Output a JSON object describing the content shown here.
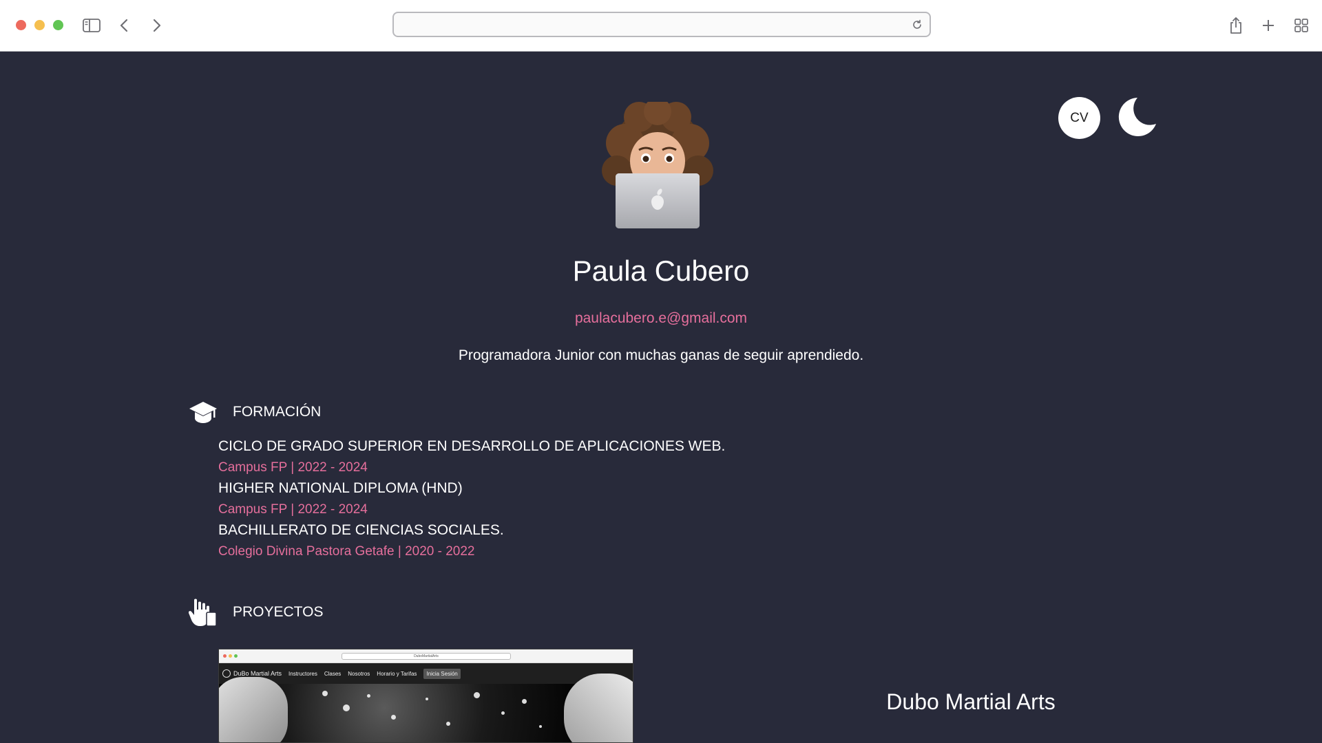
{
  "browser": {
    "url_text": "",
    "colors": {
      "close": "#ed6a5e",
      "minimize": "#f5bf4f",
      "zoom": "#61c554"
    }
  },
  "header": {
    "cv_label": "CV",
    "theme_toggle_icon": "moon-icon"
  },
  "profile": {
    "name": "Paula Cubero",
    "email": "paulacubero.e@gmail.com",
    "bio": "Programadora Junior con muchas ganas de seguir aprendiedo."
  },
  "formacion": {
    "title": "FORMACIÓN",
    "icon": "graduation-cap-icon",
    "items": [
      {
        "degree": "CICLO DE GRADO SUPERIOR EN DESARROLLO DE APLICACIONES WEB.",
        "school": "Campus FP | 2022 - 2024"
      },
      {
        "degree": "HIGHER NATIONAL DIPLOMA (HND)",
        "school": "Campus FP | 2022 - 2024"
      },
      {
        "degree": "BACHILLERATO DE CIENCIAS SOCIALES.",
        "school": "Colegio Divina Pastora Getafe | 2020 - 2022"
      }
    ]
  },
  "proyectos": {
    "title": "PROYECTOS",
    "icon": "hand-pointer-icon",
    "items": [
      {
        "title": "Dubo Martial Arts",
        "thumbnail": {
          "url": "DuboMartialArts",
          "brand": "DuBo Martial Arts",
          "nav": [
            "Instructores",
            "Clases",
            "Nosotros",
            "Horario y Tarifas"
          ],
          "login": "Inicia Sesión"
        }
      }
    ]
  },
  "colors": {
    "page_bg": "#282a3a",
    "accent": "#e66f9c",
    "text": "#ffffff"
  }
}
